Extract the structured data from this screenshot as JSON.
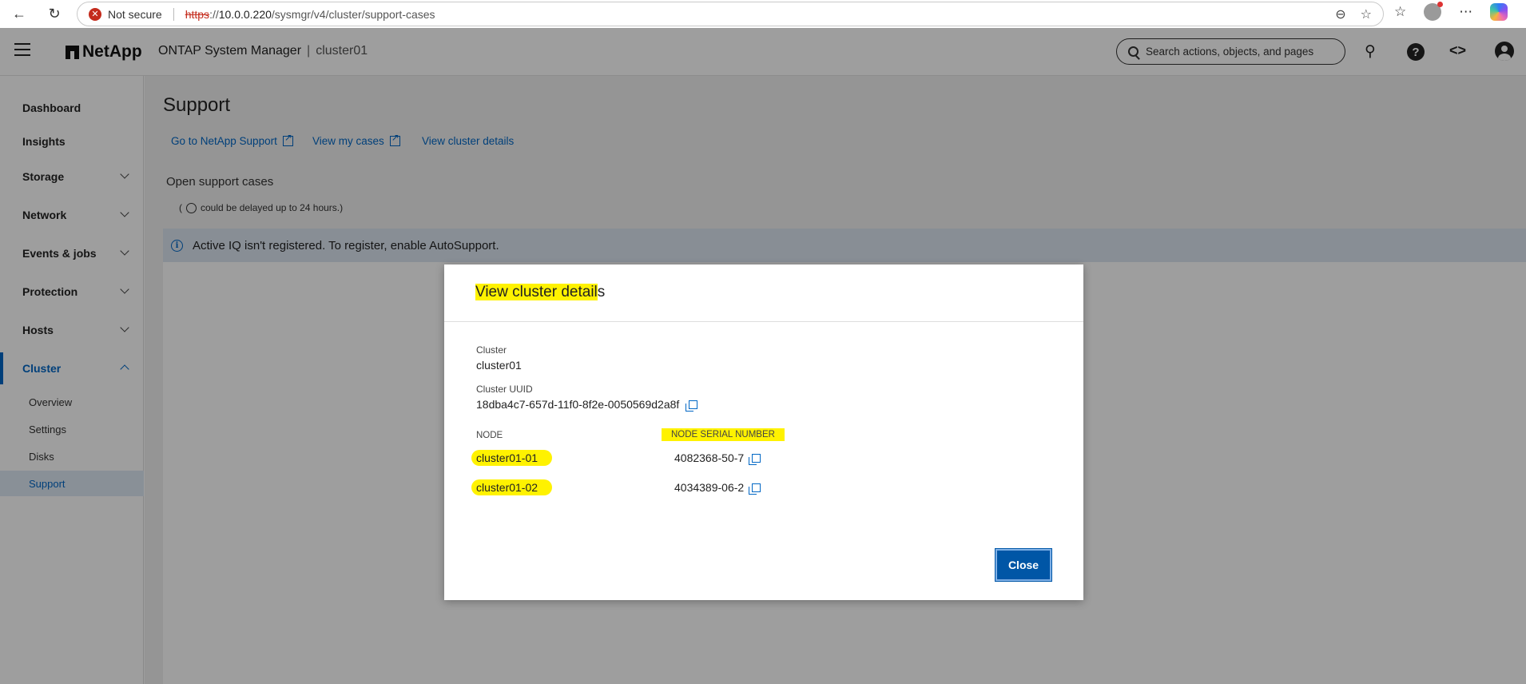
{
  "browser": {
    "security_label": "Not secure",
    "url_scheme": "https",
    "url_sep": "://",
    "url_host": "10.0.0.220",
    "url_path": "/sysmgr/v4/cluster/support-cases"
  },
  "header": {
    "brand": "NetApp",
    "product": "ONTAP System Manager",
    "separator": "|",
    "cluster": "cluster01",
    "search_placeholder": "Search actions, objects, and pages"
  },
  "sidebar": {
    "items": [
      {
        "label": "Dashboard"
      },
      {
        "label": "Insights"
      },
      {
        "label": "Storage"
      },
      {
        "label": "Network"
      },
      {
        "label": "Events & jobs"
      },
      {
        "label": "Protection"
      },
      {
        "label": "Hosts"
      },
      {
        "label": "Cluster"
      }
    ],
    "cluster_sub": [
      {
        "label": "Overview"
      },
      {
        "label": "Settings"
      },
      {
        "label": "Disks"
      },
      {
        "label": "Support"
      }
    ]
  },
  "main": {
    "title": "Support",
    "links": {
      "netapp_support": "Go to NetApp Support",
      "my_cases": "View my cases",
      "cluster_details": "View cluster details"
    },
    "open_cases_title": "Open support cases",
    "delay_open": "(",
    "delay_text": "could be delayed up to 24 hours.)",
    "banner": "Active IQ isn't registered. To register, enable AutoSupport."
  },
  "modal": {
    "title_highlighted": "View cluster detail",
    "title_rest": "s",
    "cluster_label": "Cluster",
    "cluster_value": "cluster01",
    "uuid_label": "Cluster UUID",
    "uuid_value": "18dba4c7-657d-11f0-8f2e-0050569d2a8f",
    "node_col": "NODE",
    "serial_col": "NODE SERIAL NUMBER",
    "nodes": [
      {
        "name": "cluster01-01",
        "serial": "4082368-50-7"
      },
      {
        "name": "cluster01-02",
        "serial": "4034389-06-2"
      }
    ],
    "close_label": "Close"
  },
  "colors": {
    "accent": "#0067c5",
    "highlight": "#fff200",
    "close_button": "#0056a6",
    "banner_bg": "#dbe5f1"
  }
}
